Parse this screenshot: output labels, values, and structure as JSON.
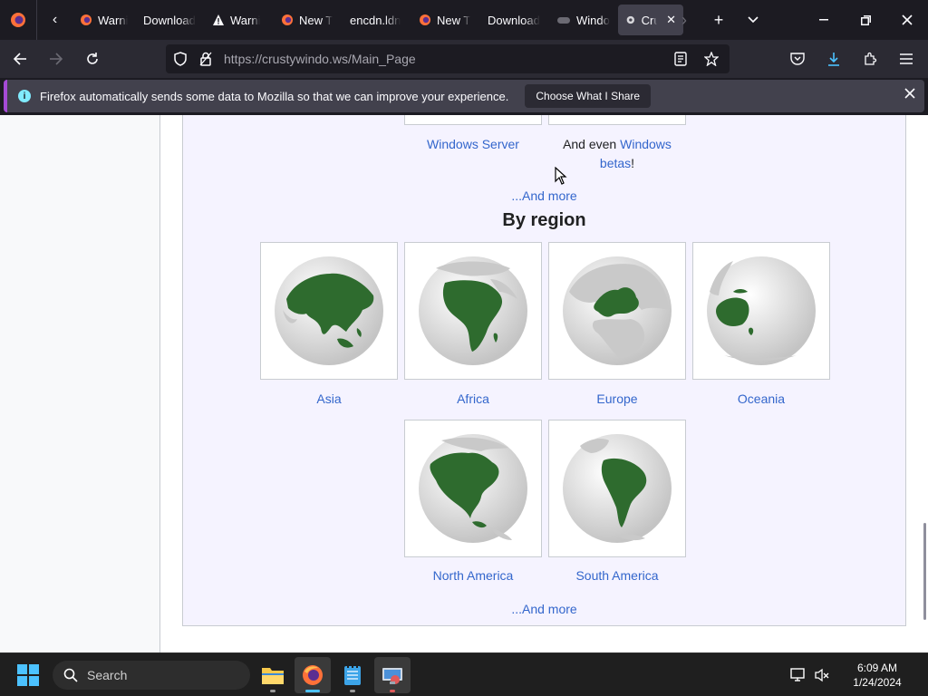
{
  "tabs": [
    {
      "label": "Warni",
      "icon": "firefox-icon",
      "active": false
    },
    {
      "label": "Download",
      "icon": "",
      "active": false
    },
    {
      "label": "Warni",
      "icon": "warning-icon",
      "active": false
    },
    {
      "label": "New T",
      "icon": "firefox-icon",
      "active": false
    },
    {
      "label": "encdn.ldn",
      "icon": "",
      "active": false
    },
    {
      "label": "New T",
      "icon": "firefox-icon",
      "active": false
    },
    {
      "label": "Download",
      "icon": "",
      "active": false
    },
    {
      "label": "Windo",
      "icon": "gamepad-icon",
      "active": false
    },
    {
      "label": "Cru",
      "icon": "site-icon",
      "active": true
    }
  ],
  "url": {
    "host": "https://crustywindo.ws",
    "path": "/Main_Page"
  },
  "notice": {
    "text": "Firefox automatically sends some data to Mozilla so that we can improve your experience.",
    "button": "Choose What I Share"
  },
  "top_section": {
    "left_caption": "Windows Server",
    "right_caption_prefix": "And even",
    "right_caption_link": "Windows betas",
    "right_caption_suffix": "!",
    "more": "...And more"
  },
  "region_section": {
    "heading": "By region",
    "regions": [
      {
        "name": "Asia"
      },
      {
        "name": "Africa"
      },
      {
        "name": "Europe"
      },
      {
        "name": "Oceania"
      },
      {
        "name": "North America"
      },
      {
        "name": "South America"
      }
    ],
    "more": "...And more"
  },
  "taskbar": {
    "search_placeholder": "Search",
    "time": "6:09 AM",
    "date": "1/24/2024"
  },
  "colors": {
    "globe_land": "#2e6b2e",
    "globe_other": "#c9c9c9",
    "link": "#3366cc",
    "accent": "#4cc2ff"
  }
}
